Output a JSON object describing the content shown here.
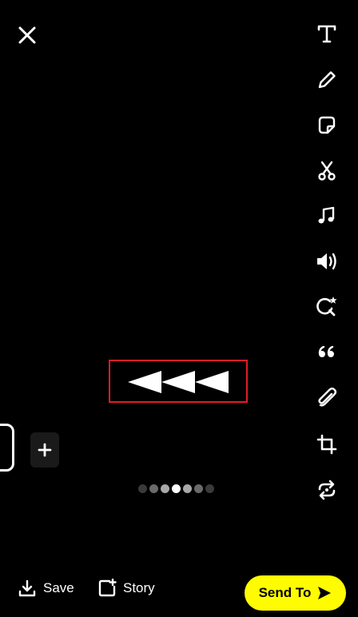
{
  "toolbar": {
    "icons": [
      "text-icon",
      "pencil-icon",
      "sticker-icon",
      "scissors-icon",
      "music-icon",
      "volume-icon",
      "lens-search-icon",
      "quote-icon",
      "paperclip-icon",
      "crop-icon",
      "loop-icon"
    ]
  },
  "overlay": {
    "symbol": "rewind-arrows",
    "highlight_color": "#e11d24"
  },
  "carousel": {
    "dot_count": 7,
    "active_index": 3
  },
  "bottom": {
    "save_label": "Save",
    "story_label": "Story",
    "send_label": "Send To"
  },
  "colors": {
    "background": "#000000",
    "accent_yellow": "#fffc00",
    "text": "#ffffff"
  }
}
